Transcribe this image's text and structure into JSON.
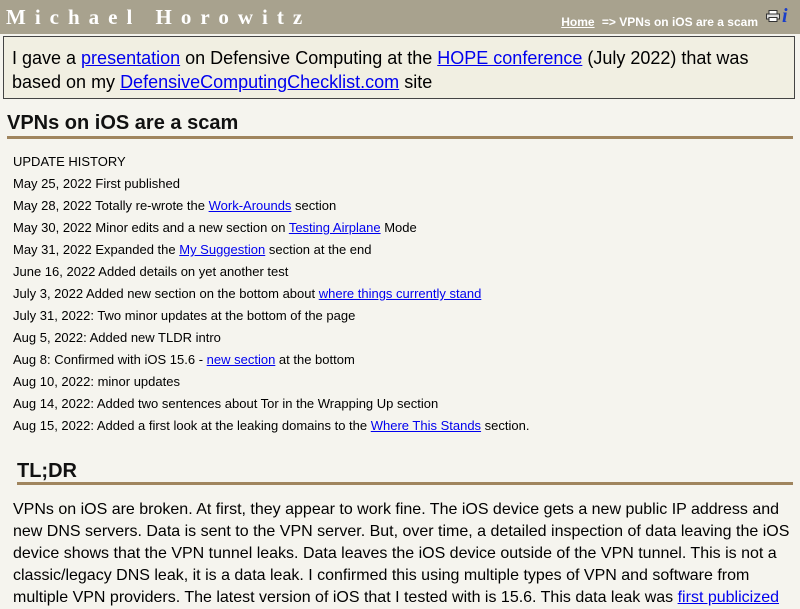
{
  "header": {
    "site_title": "Michael Horowitz",
    "home_link": "Home",
    "crumb_separator": "=>",
    "crumb_current": "VPNs on iOS are a scam",
    "print_icon": "printer-icon",
    "info_icon": "info-icon"
  },
  "banner": {
    "t1": "I gave a ",
    "link_presentation": "presentation",
    "t2": " on Defensive Computing at the ",
    "link_hope": "HOPE conference",
    "t3": " (July 2022) that was based on my ",
    "link_checklist": "DefensiveComputingChecklist.com",
    "t4": " site"
  },
  "page_heading": "VPNs on iOS are a scam",
  "history": {
    "title": "UPDATE HISTORY",
    "items": [
      {
        "before": "May 25, 2022 First published",
        "link": "",
        "after": ""
      },
      {
        "before": "May 28, 2022 Totally re-wrote the ",
        "link": "Work-Arounds",
        "after": " section"
      },
      {
        "before": "May 30, 2022 Minor edits and a new section on ",
        "link": "Testing Airplane",
        "after": " Mode"
      },
      {
        "before": "May 31, 2022 Expanded the ",
        "link": "My Suggestion",
        "after": " section at the end"
      },
      {
        "before": "June 16, 2022 Added details on yet another test",
        "link": "",
        "after": ""
      },
      {
        "before": "July 3, 2022 Added new section on the bottom about ",
        "link": "where things currently stand",
        "after": ""
      },
      {
        "before": "July 31, 2022: Two minor updates at the bottom of the page",
        "link": "",
        "after": ""
      },
      {
        "before": "Aug 5, 2022: Added new TLDR intro",
        "link": "",
        "after": ""
      },
      {
        "before": "Aug 8: Confirmed with iOS 15.6 - ",
        "link": "new section",
        "after": " at the bottom"
      },
      {
        "before": "Aug 10, 2022: minor updates",
        "link": "",
        "after": ""
      },
      {
        "before": "Aug 14, 2022: Added two sentences about Tor in the Wrapping Up section",
        "link": "",
        "after": ""
      },
      {
        "before": "Aug 15, 2022: Added a first look at the leaking domains to the ",
        "link": "Where This Stands",
        "after": " section."
      }
    ]
  },
  "tldr": {
    "heading": "TL;DR",
    "text": "VPNs on iOS are broken. At first, they appear to work fine. The iOS device gets a new public IP address and new DNS servers. Data is sent to the VPN server. But, over time, a detailed inspection of data leaving the iOS device shows that the VPN tunnel leaks. Data leaves the iOS device outside of the VPN tunnel. This is not a classic/legacy DNS leak, it is a data leak. I confirmed this using multiple types of VPN and software from multiple VPN providers. The latest version of iOS that I tested with is 15.6. This data leak was ",
    "link": "first publicized"
  }
}
